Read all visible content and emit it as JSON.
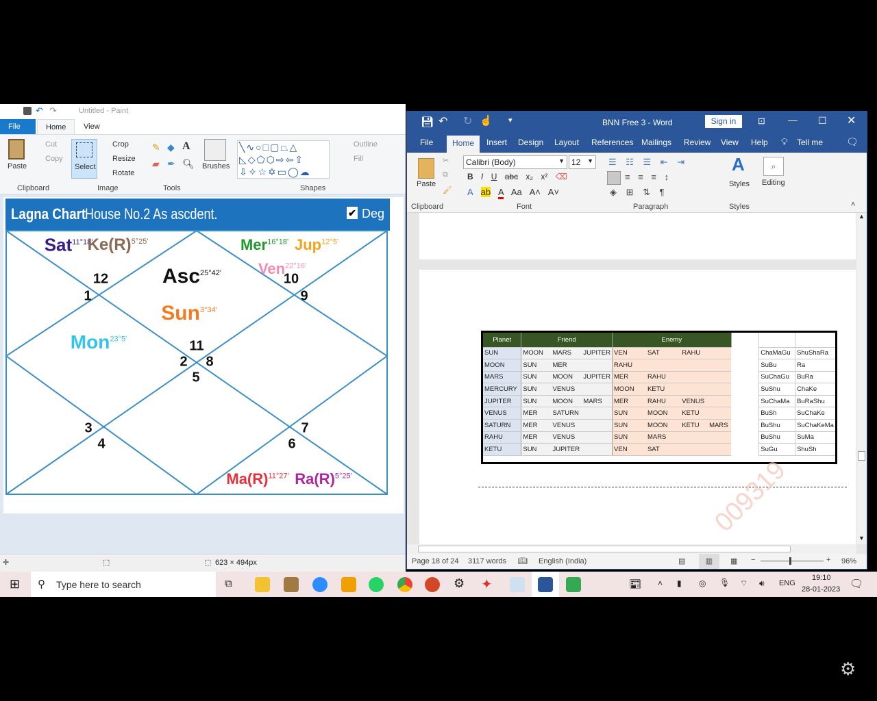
{
  "paint": {
    "title": "Untitled - Paint",
    "tabs": [
      "File",
      "Home",
      "View"
    ],
    "clipboard": {
      "paste": "Paste",
      "cut": "Cut",
      "copy": "Copy",
      "label": "Clipboard"
    },
    "image": {
      "select": "Select",
      "crop": "Crop",
      "resize": "Resize",
      "rotate": "Rotate",
      "label": "Image"
    },
    "tools_label": "Tools",
    "brushes": "Brushes",
    "shapes": {
      "outline": "Outline",
      "fill": "Fill",
      "label": "Shapes"
    },
    "status": {
      "size": "623 × 494px"
    }
  },
  "chart": {
    "title_bold": "Lagna Chart",
    "title_rest": "House No.2 As ascdent.",
    "deg_label": "Deg",
    "deg_checked": true,
    "line_color": "#3b8fc9",
    "planets": [
      {
        "name": "Sat",
        "deg": "11°18'",
        "color": "#3a1d8c"
      },
      {
        "name": "Ke(R)",
        "deg": "5°25'",
        "color": "#8b6a55"
      },
      {
        "name": "Mer",
        "deg": "16°18'",
        "color": "#1f9a2a"
      },
      {
        "name": "Jup",
        "deg": "12°5'",
        "color": "#f5a11a"
      },
      {
        "name": "Ven",
        "deg": "22°16'",
        "color": "#f28cb0"
      },
      {
        "name": "Asc",
        "deg": "25°42'",
        "color": "#111111"
      },
      {
        "name": "Sun",
        "deg": "3°34'",
        "color": "#f47a20"
      },
      {
        "name": "Mon",
        "deg": "23°5'",
        "color": "#33c3ec"
      },
      {
        "name": "Ma(R)",
        "deg": "11°27'",
        "color": "#e8303a"
      },
      {
        "name": "Ra(R)",
        "deg": "5°25'",
        "color": "#b0279b"
      }
    ],
    "houses": [
      "12",
      "1",
      "10",
      "9",
      "11",
      "2",
      "8",
      "5",
      "3",
      "4",
      "7",
      "6"
    ]
  },
  "word": {
    "title": "BNN Free 3  -  Word",
    "sign_in": "Sign in",
    "tabs": [
      "File",
      "Home",
      "Insert",
      "Design",
      "Layout",
      "References",
      "Mailings",
      "Review",
      "View",
      "Help",
      "Tell me"
    ],
    "font_name": "Calibri (Body)",
    "font_size": "12",
    "groups": {
      "clipboard": "Clipboard",
      "font": "Font",
      "paragraph": "Paragraph",
      "styles": "Styles"
    },
    "paste": "Paste",
    "styles_btn": "Styles",
    "editing": "Editing",
    "status": {
      "page": "Page 18 of 24",
      "words": "3117 words",
      "language": "English (India)",
      "zoom": "96%"
    },
    "table": {
      "headers": [
        "Planet",
        "Friend",
        "Enemy"
      ],
      "rows": [
        {
          "planet": "SUN",
          "friend": [
            "MOON",
            "MARS",
            "JUPITER"
          ],
          "enemy": [
            "VEN",
            "SAT",
            "RAHU",
            ""
          ],
          "a": "ChaMaGu",
          "b": "ShuShaRa"
        },
        {
          "planet": "MOON",
          "friend": [
            "SUN",
            "MER",
            ""
          ],
          "enemy": [
            "RAHU",
            "",
            "",
            ""
          ],
          "a": "SuBu",
          "b": "Ra"
        },
        {
          "planet": "MARS",
          "friend": [
            "SUN",
            "MOON",
            "JUPITER"
          ],
          "enemy": [
            "MER",
            "RAHU",
            "",
            ""
          ],
          "a": "SuChaGu",
          "b": "BuRa"
        },
        {
          "planet": "MERCURY",
          "friend": [
            "SUN",
            "VENUS",
            ""
          ],
          "enemy": [
            "MOON",
            "KETU",
            "",
            ""
          ],
          "a": "SuShu",
          "b": "ChaKe"
        },
        {
          "planet": "JUPITER",
          "friend": [
            "SUN",
            "MOON",
            "MARS"
          ],
          "enemy": [
            "MER",
            "RAHU",
            "VENUS",
            ""
          ],
          "a": "SuChaMa",
          "b": "BuRaShu"
        },
        {
          "planet": "VENUS",
          "friend": [
            "MER",
            "SATURN",
            ""
          ],
          "enemy": [
            "SUN",
            "MOON",
            "KETU",
            ""
          ],
          "a": "BuSh",
          "b": "SuChaKe"
        },
        {
          "planet": "SATURN",
          "friend": [
            "MER",
            "VENUS",
            ""
          ],
          "enemy": [
            "SUN",
            "MOON",
            "KETU",
            "MARS"
          ],
          "a": "BuShu",
          "b": "SuChaKeMa"
        },
        {
          "planet": "RAHU",
          "friend": [
            "MER",
            "VENUS",
            ""
          ],
          "enemy": [
            "SUN",
            "MARS",
            "",
            ""
          ],
          "a": "BuShu",
          "b": "SuMa"
        },
        {
          "planet": "KETU",
          "friend": [
            "SUN",
            "JUPITER",
            ""
          ],
          "enemy": [
            "VEN",
            "SAT",
            "",
            ""
          ],
          "a": "SuGu",
          "b": "ShuSh"
        }
      ]
    },
    "watermark": "009319"
  },
  "taskbar": {
    "search_placeholder": "Type here to search",
    "time": "19:10",
    "date": "28-01-2023",
    "lang": "ENG"
  }
}
